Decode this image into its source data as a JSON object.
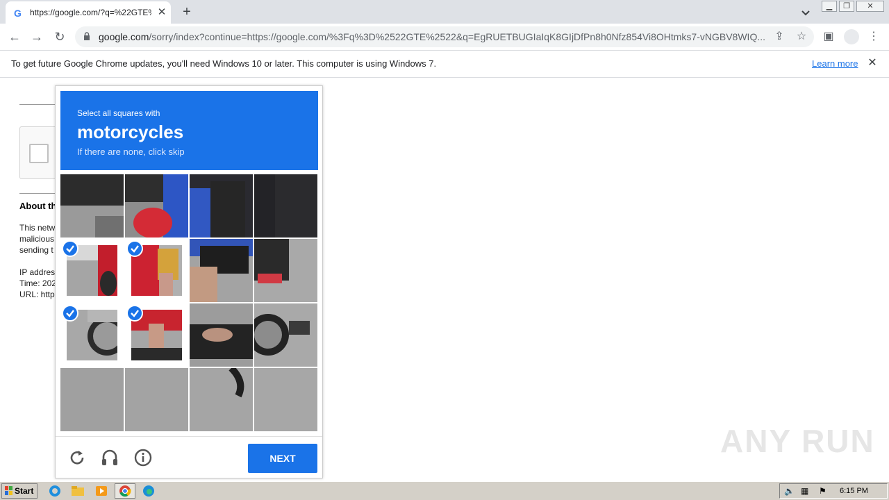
{
  "browser": {
    "tab_title": "https://google.com/?q=%22GTE%2",
    "url_host": "google.com",
    "url_rest": "/sorry/index?continue=https://google.com/%3Fq%3D%2522GTE%2522&q=EgRUETBUGIaIqK8GIjDfPn8h0Nfz854Vi8OHtmks7-vNGBV8WIQ..."
  },
  "infobar": {
    "message": "To get future Google Chrome updates, you'll need Windows 10 or later. This computer is using Windows 7.",
    "link": "Learn more"
  },
  "background_page": {
    "about_heading": "About th",
    "line1": "This netw",
    "line2": "malicious",
    "line3": "sending t",
    "ip": "IP addres",
    "time": "Time: 202",
    "url": "URL: http"
  },
  "challenge": {
    "instruction": "Select all squares with",
    "target": "motorcycles",
    "hint": "If there are none, click skip",
    "next_label": "NEXT",
    "selected_tiles": [
      4,
      5,
      8,
      9
    ]
  },
  "watermark": "ANY RUN",
  "taskbar": {
    "start_label": "Start",
    "clock": "6:15 PM"
  }
}
